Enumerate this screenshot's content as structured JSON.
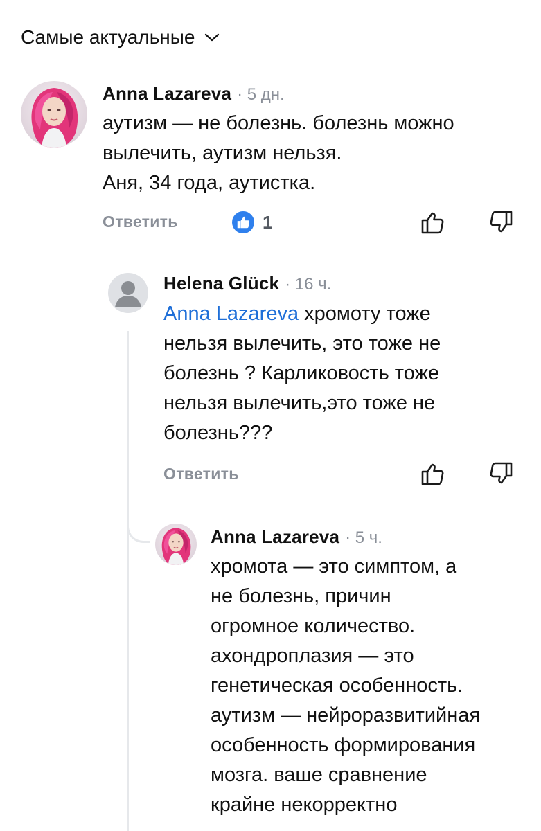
{
  "sort": {
    "label": "Самые актуальные",
    "icon": "chevron-down-icon"
  },
  "comments": [
    {
      "author": "Anna Lazareva",
      "meta": "· 5 дн.",
      "text": "аутизм — не болезнь. болезнь можно\nвылечить, аутизм нельзя.\nАня, 34 года, аутистка.",
      "reply_label": "Ответить",
      "likes": "1",
      "avatar": "profile-photo-pink-hair"
    },
    {
      "author": "Helena Glück",
      "meta": "· 16 ч.",
      "mention": "Anna Lazareva",
      "text_first": " хромоту тоже",
      "text_rest": "нельзя вылечить, это тоже не\nболезнь ?  Карликовость тоже\nнельзя вылечить,это тоже не\nболезнь???",
      "reply_label": "Ответить",
      "avatar": "default-user-avatar"
    },
    {
      "author": "Anna Lazareva",
      "meta": "· 5 ч.",
      "text": "хромота — это симптом, а\nне болезнь, причин\nогромное количество.\nахондроплазия — это\nгенетическая особенность.\nаутизм — нейроразвитийная\nособенность формирования\nмозга. ваше сравнение\nкрайне некорректно",
      "avatar": "profile-photo-pink-hair"
    }
  ],
  "colors": {
    "mention": "#1f6fd8",
    "like_badge": "#2f80ed",
    "muted": "#8a8f98",
    "thread_line": "#e6e8eb"
  }
}
